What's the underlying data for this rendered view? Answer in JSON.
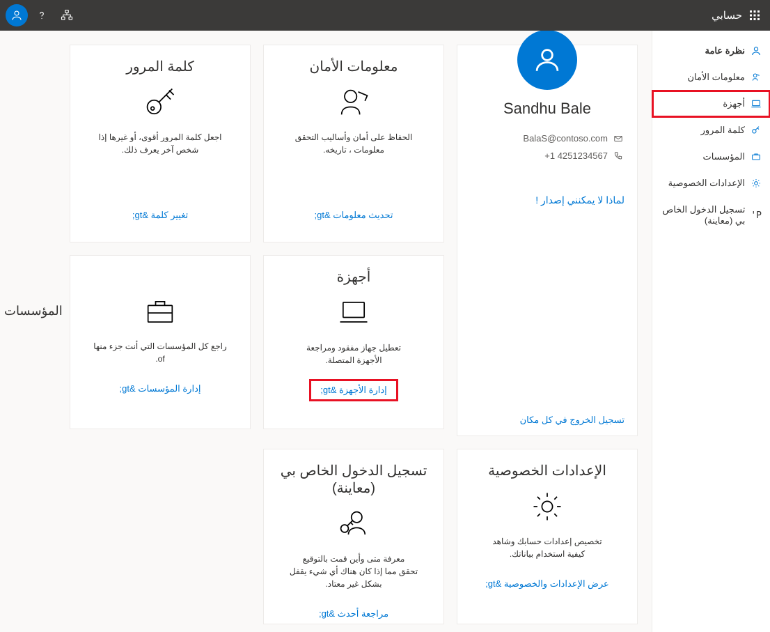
{
  "topbar": {
    "brand": "حسابي"
  },
  "sidebar": {
    "items": [
      {
        "label": "نظرة عامة"
      },
      {
        "label": "معلومات الأمان"
      },
      {
        "label": "أجهزة"
      },
      {
        "label": "كلمة المرور"
      },
      {
        "label": "المؤسسات"
      },
      {
        "label": "الإعدادات الخصوصية"
      },
      {
        "label": "تسجيل الدخول الخاص بي (معاينة)"
      }
    ]
  },
  "profile": {
    "name": "Sandhu Bale",
    "email": "BalaS@contoso.com",
    "phone": "+1 4251234567",
    "why_link": "لماذا لا يمكنني إصدار !",
    "signout": "تسجيل الخروج في كل مكان"
  },
  "cards": {
    "security": {
      "title": "معلومات الأمان",
      "desc": "الحفاظ على أمان وأساليب التحقق\nمعلومات ، تاريخه.",
      "link": "تحديث معلومات &gt;"
    },
    "password": {
      "title": "كلمة المرور",
      "desc": "اجعل كلمة المرور أقوى، أو غيرها إذا\nشخص آخر يعرف ذلك.",
      "link": "تغيير كلمة &gt;"
    },
    "devices": {
      "title": "أجهزة",
      "desc": "تعطيل جهاز مفقود ومراجعة\nالأجهزة المتصلة.",
      "link": "إدارة الأجهزة &gt;"
    },
    "orgs": {
      "title": "المؤسسات",
      "stray_heading": "المؤسسات",
      "desc": "راجع كل المؤسسات التي أنت جزء منها of.",
      "link": "إدارة المؤسسات &gt;"
    },
    "privacy": {
      "title": "الإعدادات الخصوصية",
      "desc": "تخصيص إعدادات حسابك وشاهد\nكيفية استخدام بياناتك.",
      "link": "عرض الإعدادات والخصوصية &gt;"
    },
    "signins": {
      "title": "تسجيل الدخول الخاص بي (معاينة)",
      "desc": "معرفة متى وأين قمت بالتوقيع\nتحقق مما إذا كان هناك أي شيء يقفل بشكل غير معتاد.",
      "link": "مراجعة أحدث &gt;"
    }
  }
}
